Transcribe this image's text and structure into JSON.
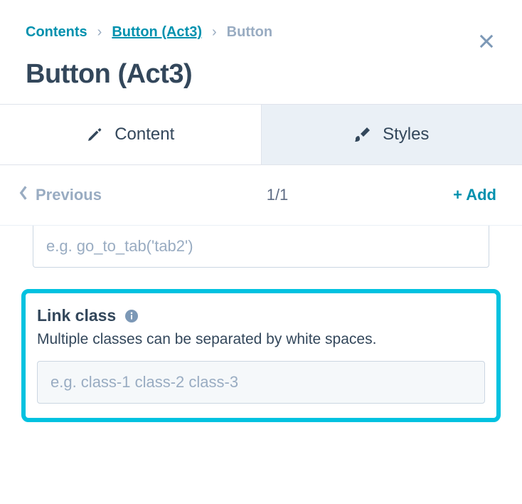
{
  "breadcrumb": {
    "root": "Contents",
    "mid": "Button (Act3)",
    "current": "Button"
  },
  "title": "Button (Act3)",
  "tabs": {
    "content": "Content",
    "styles": "Styles"
  },
  "nav": {
    "previous": "Previous",
    "count": "1/1",
    "add": "+ Add"
  },
  "fields": {
    "onclick": {
      "placeholder": "e.g. go_to_tab('tab2')",
      "value": ""
    },
    "link_class": {
      "label": "Link class",
      "help": "Multiple classes can be separated by white spaces.",
      "placeholder": "e.g. class-1 class-2 class-3",
      "value": ""
    }
  }
}
